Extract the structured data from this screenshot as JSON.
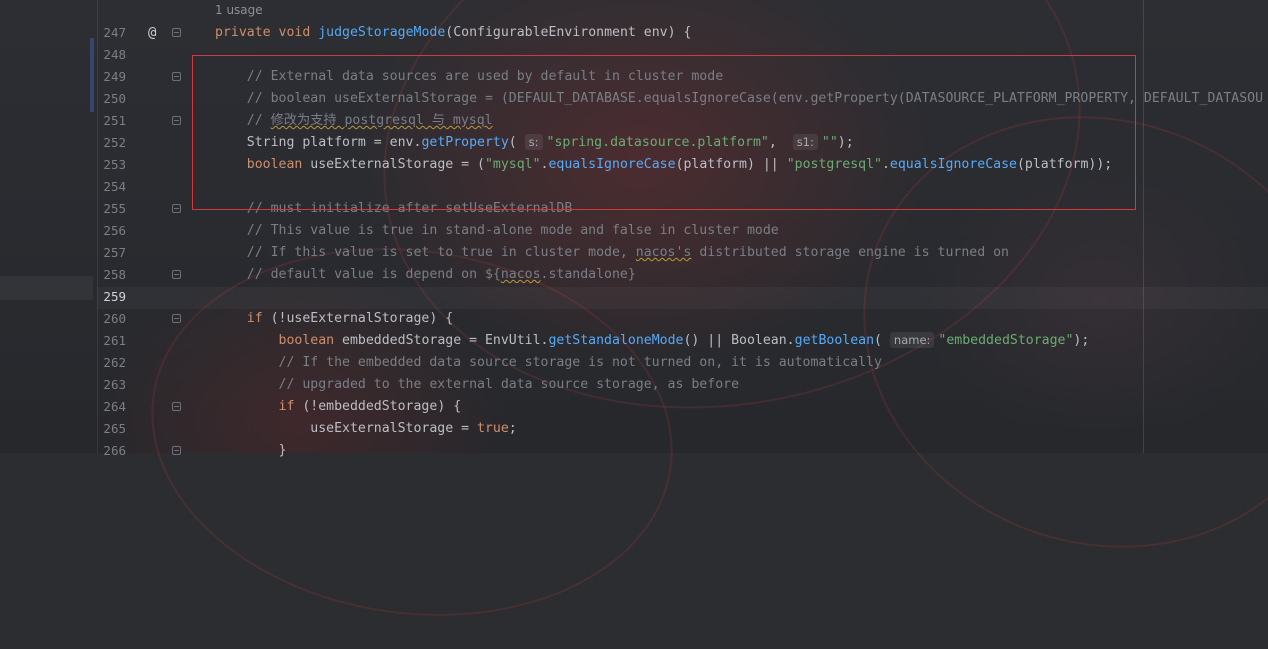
{
  "editor": {
    "usage_hint": "1 usage",
    "lines": [
      {
        "num": "247",
        "segments": [
          [
            "kw",
            "private "
          ],
          [
            "kw",
            "void "
          ],
          [
            "fn",
            "judgeStorageMode"
          ],
          [
            "cls",
            "(ConfigurableEnvironment "
          ],
          [
            "cls",
            "env) {"
          ]
        ]
      },
      {
        "num": "248",
        "segments": []
      },
      {
        "num": "249",
        "segments": [
          [
            "cmt",
            "    // External data sources are used by default in cluster mode"
          ]
        ]
      },
      {
        "num": "250",
        "segments": [
          [
            "cmt",
            "    // boolean useExternalStorage = (DEFAULT_DATABASE.equalsIgnoreCase(env.getProperty(DATASOURCE_PLATFORM_PROPERTY, DEFAULT_DATASOU"
          ]
        ]
      },
      {
        "num": "251",
        "segments": [
          [
            "cmt",
            "    // "
          ],
          [
            "cmt-w",
            "修改为支持 postgresql 与 mysql"
          ]
        ]
      },
      {
        "num": "252",
        "segments": [
          [
            "cls",
            "    String platform = env."
          ],
          [
            "method",
            "getProperty"
          ],
          [
            "cls",
            "( "
          ],
          [
            "hint",
            "s:"
          ],
          [
            "str",
            "\"spring.datasource.platform\""
          ],
          [
            "cls",
            ",  "
          ],
          [
            "hint",
            "s1:"
          ],
          [
            "str",
            "\"\""
          ],
          [
            "cls",
            ");"
          ]
        ]
      },
      {
        "num": "253",
        "segments": [
          [
            "kw",
            "    boolean "
          ],
          [
            "cls",
            "useExternalStorage = ("
          ],
          [
            "str",
            "\"mysql\""
          ],
          [
            "cls",
            "."
          ],
          [
            "method",
            "equalsIgnoreCase"
          ],
          [
            "cls",
            "(platform) || "
          ],
          [
            "str",
            "\"postgresql\""
          ],
          [
            "cls",
            "."
          ],
          [
            "method",
            "equalsIgnoreCase"
          ],
          [
            "cls",
            "(platform));"
          ]
        ]
      },
      {
        "num": "254",
        "segments": []
      },
      {
        "num": "255",
        "segments": [
          [
            "cmt",
            "    // must initialize after setUseExternalDB"
          ]
        ]
      },
      {
        "num": "256",
        "segments": [
          [
            "cmt",
            "    // This value is true in stand-alone mode and false in cluster mode"
          ]
        ]
      },
      {
        "num": "257",
        "segments": [
          [
            "cmt",
            "    // If this value is set to true in cluster mode, "
          ],
          [
            "cmt-w",
            "nacos's"
          ],
          [
            "cmt",
            " distributed storage engine is turned on"
          ]
        ]
      },
      {
        "num": "258",
        "segments": [
          [
            "cmt",
            "    // default value is depend on ${"
          ],
          [
            "cmt-w",
            "nacos"
          ],
          [
            "cmt",
            ".standalone}"
          ]
        ]
      },
      {
        "num": "259",
        "segments": []
      },
      {
        "num": "260",
        "segments": [
          [
            "kw",
            "    if "
          ],
          [
            "cls",
            "(!useExternalStorage) {"
          ]
        ]
      },
      {
        "num": "261",
        "segments": [
          [
            "kw",
            "        boolean "
          ],
          [
            "cls",
            "embeddedStorage = EnvUtil."
          ],
          [
            "method",
            "getStandaloneMode"
          ],
          [
            "cls",
            "() || Boolean."
          ],
          [
            "method",
            "getBoolean"
          ],
          [
            "cls",
            "( "
          ],
          [
            "hint",
            "name:"
          ],
          [
            "str",
            "\"embeddedStorage\""
          ],
          [
            "cls",
            ");"
          ]
        ]
      },
      {
        "num": "262",
        "segments": [
          [
            "cmt",
            "        // If the embedded data source storage is not turned on, it is automatically"
          ]
        ]
      },
      {
        "num": "263",
        "segments": [
          [
            "cmt",
            "        // upgraded to the external data source storage, as before"
          ]
        ]
      },
      {
        "num": "264",
        "segments": [
          [
            "kw",
            "        if "
          ],
          [
            "cls",
            "(!embeddedStorage) {"
          ]
        ]
      },
      {
        "num": "265",
        "segments": [
          [
            "cls",
            "            useExternalStorage = "
          ],
          [
            "kw",
            "true"
          ],
          [
            "cls",
            ";"
          ]
        ]
      },
      {
        "num": "266",
        "segments": [
          [
            "cls",
            "        }"
          ]
        ]
      }
    ]
  }
}
